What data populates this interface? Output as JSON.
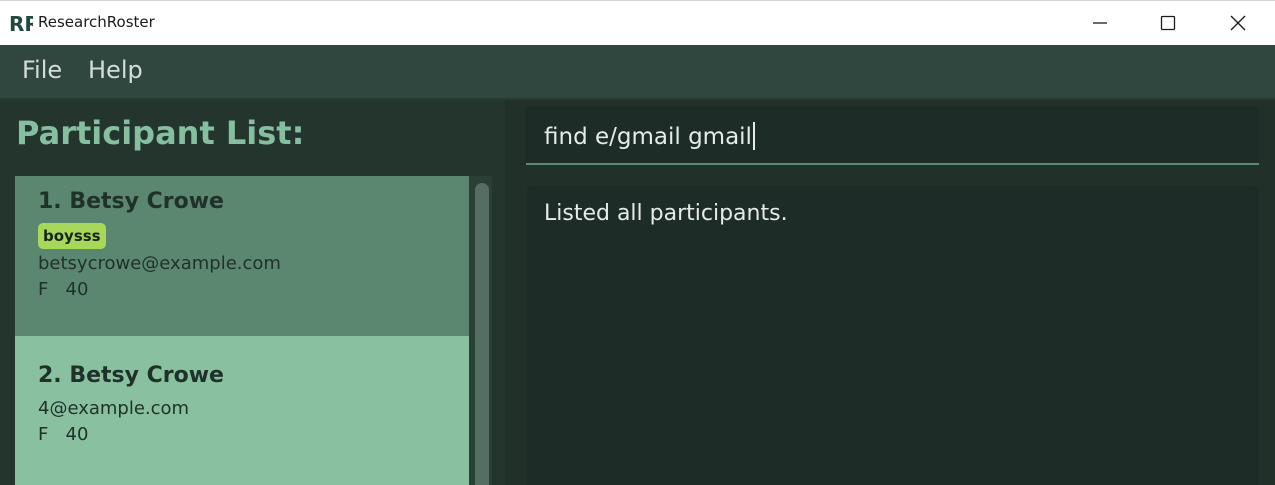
{
  "window": {
    "title": "ResearchRoster",
    "logo_text": "RR",
    "controls": [
      "minimize-icon",
      "maximize-icon",
      "close-icon"
    ]
  },
  "menu": {
    "items": [
      "File",
      "Help"
    ]
  },
  "participant_list": {
    "heading": "Participant List:",
    "participants": [
      {
        "name": "1. Betsy Crowe",
        "tag": "boysss",
        "email": "betsycrowe@example.com",
        "gender": "F",
        "age": "40"
      },
      {
        "name": "2. Betsy Crowe",
        "email": "4@example.com",
        "gender": "F",
        "age": "40"
      }
    ]
  },
  "command": {
    "value": "find e/gmail gmail"
  },
  "result": {
    "message": "Listed all participants."
  },
  "colors": {
    "menu_bg": "#2f473e",
    "panel_bg": "#24352e",
    "heading": "#86bea0",
    "card_selected": "#5b8771",
    "card_default": "#88c0a0",
    "tag_bg": "#a8d85a",
    "input_bg": "#1e2c27"
  }
}
